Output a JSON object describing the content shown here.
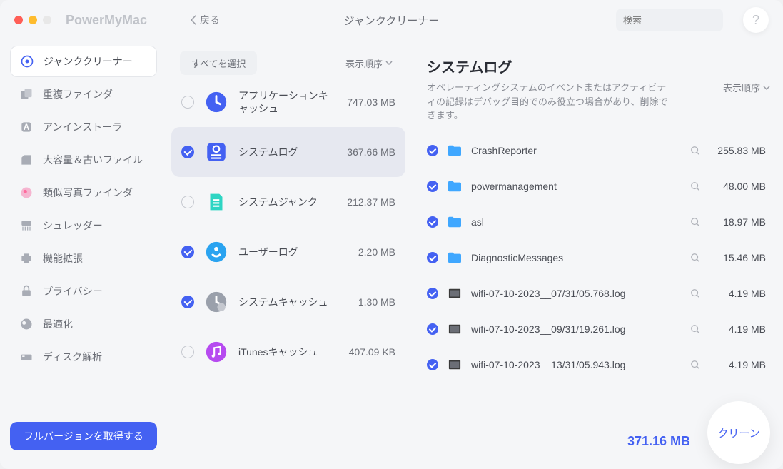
{
  "app_title": "PowerMyMac",
  "back_label": "戻る",
  "window_title": "ジャンククリーナー",
  "search_placeholder": "検索",
  "help_label": "?",
  "sidebar": {
    "items": [
      {
        "label": "ジャンククリーナー",
        "icon": "junk",
        "active": true
      },
      {
        "label": "重複ファインダ",
        "icon": "dup"
      },
      {
        "label": "アンインストーラ",
        "icon": "uninst"
      },
      {
        "label": "大容量＆古いファイル",
        "icon": "large"
      },
      {
        "label": "類似写真ファインダ",
        "icon": "photos"
      },
      {
        "label": "シュレッダー",
        "icon": "shred"
      },
      {
        "label": "機能拡張",
        "icon": "ext"
      },
      {
        "label": "プライバシー",
        "icon": "priv"
      },
      {
        "label": "最適化",
        "icon": "opt"
      },
      {
        "label": "ディスク解析",
        "icon": "disk"
      }
    ],
    "full_version": "フルバージョンを取得する"
  },
  "categories": {
    "select_all": "すべてを選択",
    "sort_label": "表示順序",
    "items": [
      {
        "name": "アプリケーションキャッシュ",
        "size": "747.03 MB",
        "checked": false,
        "color": "#4461f2",
        "icon": "appcache"
      },
      {
        "name": "システムログ",
        "size": "367.66 MB",
        "checked": true,
        "selected": true,
        "color": "#4461f2",
        "icon": "syslog"
      },
      {
        "name": "システムジャンク",
        "size": "212.37 MB",
        "checked": false,
        "color": "#2ed5c3",
        "icon": "sysjunk"
      },
      {
        "name": "ユーザーログ",
        "size": "2.20 MB",
        "checked": true,
        "color": "#2aa3f0",
        "icon": "userlog"
      },
      {
        "name": "システムキャッシュ",
        "size": "1.30 MB",
        "checked": true,
        "color": "#9aa0ab",
        "icon": "syscache"
      },
      {
        "name": "iTunesキャッシュ",
        "size": "407.09 KB",
        "checked": false,
        "color": "#b64af0",
        "icon": "itunes"
      }
    ]
  },
  "detail": {
    "title": "システムログ",
    "desc": "オペレーティングシステムのイベントまたはアクティビティの記録はデバッグ目的でのみ役立つ場合があり、削除できます。",
    "sort_label": "表示順序",
    "files": [
      {
        "name": "CrashReporter",
        "size": "255.83 MB",
        "type": "folder",
        "color": "#3fa7ff"
      },
      {
        "name": "powermanagement",
        "size": "48.00 MB",
        "type": "folder",
        "color": "#3fa7ff"
      },
      {
        "name": "asl",
        "size": "18.97 MB",
        "type": "folder",
        "color": "#3fa7ff"
      },
      {
        "name": "DiagnosticMessages",
        "size": "15.46 MB",
        "type": "folder",
        "color": "#3fa7ff"
      },
      {
        "name": "wifi-07-10-2023__07/31/05.768.log",
        "size": "4.19 MB",
        "type": "file"
      },
      {
        "name": "wifi-07-10-2023__09/31/19.261.log",
        "size": "4.19 MB",
        "type": "file"
      },
      {
        "name": "wifi-07-10-2023__13/31/05.943.log",
        "size": "4.19 MB",
        "type": "file"
      }
    ]
  },
  "total_size": "371.16 MB",
  "clean_label": "クリーン"
}
